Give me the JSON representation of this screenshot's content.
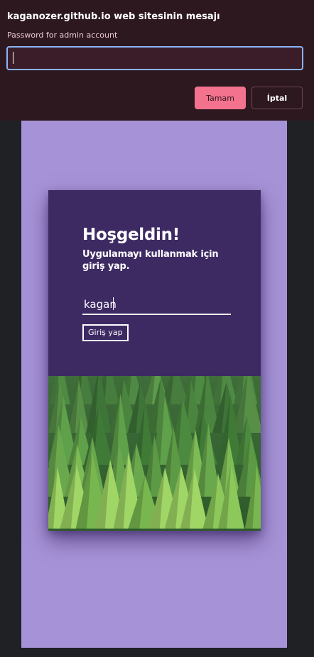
{
  "dialog": {
    "title": "kaganozer.github.io web sitesinin mesajı",
    "message": "Password for admin account",
    "input_value": "",
    "ok_label": "Tamam",
    "cancel_label": "İptal"
  },
  "login": {
    "heading": "Hoşgeldin!",
    "subheading": "Uygulamayı kullanmak için giriş yap.",
    "name_value": "kagan",
    "button_label": "Giriş yap"
  },
  "colors": {
    "dialog_bg": "#2e1820",
    "accent": "#f3728d",
    "focus_ring": "#8ab4f8",
    "site_bg": "#a692d6",
    "card_bg": "#3d2a63"
  },
  "images": {
    "card_image": "pine-forest-image"
  }
}
